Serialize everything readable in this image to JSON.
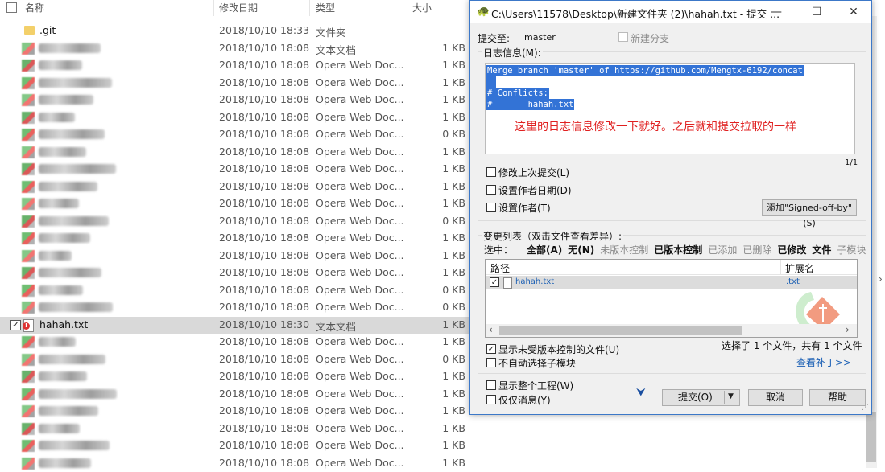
{
  "explorer": {
    "columns": {
      "name": "名称",
      "date": "修改日期",
      "type": "类型",
      "size": "大小"
    },
    "rows": [
      {
        "name": ".git",
        "date": "2018/10/10 18:33",
        "type": "文件夹",
        "size": "",
        "kind": "folder"
      },
      {
        "name": "",
        "date": "2018/10/10 18:08",
        "type": "文本文档",
        "size": "1 KB",
        "kind": "blur"
      },
      {
        "name": "",
        "date": "2018/10/10 18:08",
        "type": "Opera Web Doc...",
        "size": "1 KB",
        "kind": "blur"
      },
      {
        "name": "",
        "date": "2018/10/10 18:08",
        "type": "Opera Web Doc...",
        "size": "1 KB",
        "kind": "blur"
      },
      {
        "name": "",
        "date": "2018/10/10 18:08",
        "type": "Opera Web Doc...",
        "size": "1 KB",
        "kind": "blur"
      },
      {
        "name": "",
        "date": "2018/10/10 18:08",
        "type": "Opera Web Doc...",
        "size": "1 KB",
        "kind": "blur"
      },
      {
        "name": "",
        "date": "2018/10/10 18:08",
        "type": "Opera Web Doc...",
        "size": "0 KB",
        "kind": "blur"
      },
      {
        "name": "",
        "date": "2018/10/10 18:08",
        "type": "Opera Web Doc...",
        "size": "1 KB",
        "kind": "blur"
      },
      {
        "name": "",
        "date": "2018/10/10 18:08",
        "type": "Opera Web Doc...",
        "size": "1 KB",
        "kind": "blur"
      },
      {
        "name": "",
        "date": "2018/10/10 18:08",
        "type": "Opera Web Doc...",
        "size": "1 KB",
        "kind": "blur"
      },
      {
        "name": "",
        "date": "2018/10/10 18:08",
        "type": "Opera Web Doc...",
        "size": "1 KB",
        "kind": "blur"
      },
      {
        "name": "",
        "date": "2018/10/10 18:08",
        "type": "Opera Web Doc...",
        "size": "0 KB",
        "kind": "blur"
      },
      {
        "name": "",
        "date": "2018/10/10 18:08",
        "type": "Opera Web Doc...",
        "size": "1 KB",
        "kind": "blur"
      },
      {
        "name": "",
        "date": "2018/10/10 18:08",
        "type": "Opera Web Doc...",
        "size": "1 KB",
        "kind": "blur"
      },
      {
        "name": "",
        "date": "2018/10/10 18:08",
        "type": "Opera Web Doc...",
        "size": "1 KB",
        "kind": "blur"
      },
      {
        "name": "",
        "date": "2018/10/10 18:08",
        "type": "Opera Web Doc...",
        "size": "0 KB",
        "kind": "blur"
      },
      {
        "name": "",
        "date": "2018/10/10 18:08",
        "type": "Opera Web Doc...",
        "size": "0 KB",
        "kind": "blur"
      },
      {
        "name": "hahah.txt",
        "date": "2018/10/10 18:30",
        "type": "文本文档",
        "size": "1 KB",
        "kind": "txt",
        "selected": true
      },
      {
        "name": "",
        "date": "2018/10/10 18:08",
        "type": "Opera Web Doc...",
        "size": "1 KB",
        "kind": "blur"
      },
      {
        "name": "",
        "date": "2018/10/10 18:08",
        "type": "Opera Web Doc...",
        "size": "0 KB",
        "kind": "blur"
      },
      {
        "name": "",
        "date": "2018/10/10 18:08",
        "type": "Opera Web Doc...",
        "size": "1 KB",
        "kind": "blur"
      },
      {
        "name": "",
        "date": "2018/10/10 18:08",
        "type": "Opera Web Doc...",
        "size": "1 KB",
        "kind": "blur"
      },
      {
        "name": "",
        "date": "2018/10/10 18:08",
        "type": "Opera Web Doc...",
        "size": "1 KB",
        "kind": "blur"
      },
      {
        "name": "",
        "date": "2018/10/10 18:08",
        "type": "Opera Web Doc...",
        "size": "1 KB",
        "kind": "blur"
      },
      {
        "name": "",
        "date": "2018/10/10 18:08",
        "type": "Opera Web Doc...",
        "size": "1 KB",
        "kind": "blur"
      },
      {
        "name": "",
        "date": "2018/10/10 18:08",
        "type": "Opera Web Doc...",
        "size": "1 KB",
        "kind": "blur"
      }
    ]
  },
  "dialog": {
    "title": "C:\\Users\\11578\\Desktop\\新建文件夹 (2)\\hahah.txt - 提交 ...",
    "minimize": "—",
    "maximize": "☐",
    "close": "✕",
    "commit_to_label": "提交至:",
    "branch": "master",
    "new_branch_label": "新建分支",
    "log_label": "日志信息(M):",
    "message_lines": [
      "Merge branch 'master' of https://github.com/Mengtx-6192/concat",
      " ",
      "# Conflicts:",
      "#       hahah.txt"
    ],
    "annotation": "这里的日志信息修改一下就好。之后就和提交拉取的一样",
    "page_indicator": "1/1",
    "amend_label": "修改上次提交(L)",
    "set_date_label": "设置作者日期(D)",
    "set_author_label": "设置作者(T)",
    "signed_off_button": "添加\"Signed-off-by\"(S)",
    "changes_label": "变更列表（双击文件查看差异）:",
    "select_label": "选中：",
    "filters": [
      {
        "label": "全部(A)",
        "bold": true
      },
      {
        "label": "无(N)",
        "bold": true
      },
      {
        "label": "未版本控制",
        "bold": false
      },
      {
        "label": "已版本控制",
        "bold": true
      },
      {
        "label": "已添加",
        "bold": false
      },
      {
        "label": "已删除",
        "bold": false
      },
      {
        "label": "已修改",
        "bold": true
      },
      {
        "label": "文件",
        "bold": true
      },
      {
        "label": "子模块",
        "bold": false
      }
    ],
    "list_headers": {
      "path": "路径",
      "ext": "扩展名"
    },
    "files": [
      {
        "path": "hahah.txt",
        "ext": ".txt",
        "checked": true
      }
    ],
    "show_unversioned_label": "显示未受版本控制的文件(U)",
    "selection_summary": "选择了 1 个文件，共有 1 个文件",
    "no_submodules_label": "不自动选择子模块",
    "view_patch_link": "查看补丁>>",
    "show_whole_project_label": "显示整个工程(W)",
    "message_only_label": "仅仅消息(Y)",
    "commit_button": "提交(O)",
    "cancel_button": "取消",
    "help_button": "帮助"
  }
}
